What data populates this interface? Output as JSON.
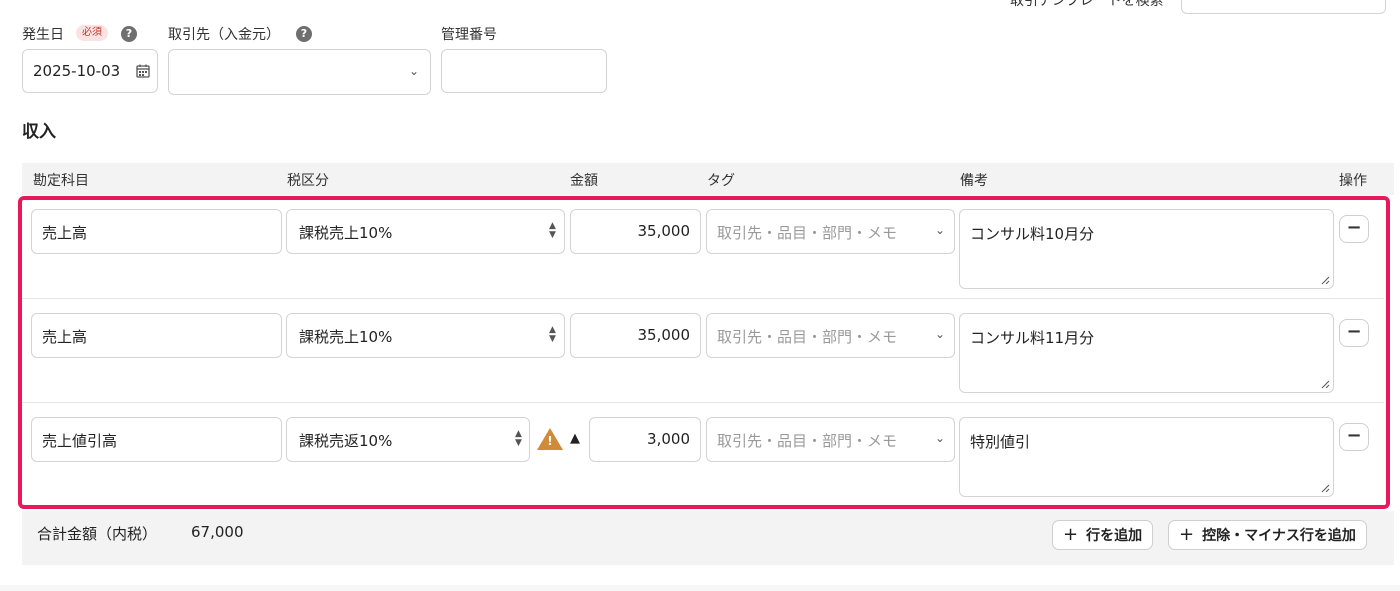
{
  "header": {
    "date_label": "発生日",
    "required_badge": "必須",
    "partner_label": "取引先（入金元）",
    "manage_no_label": "管理番号",
    "template_search_label": "取引テンプレートを検索"
  },
  "form": {
    "date_value": "2025-10-03",
    "partner_value": "",
    "manage_no_value": ""
  },
  "section": {
    "title": "収入"
  },
  "table": {
    "headers": [
      "勘定科目",
      "税区分",
      "金額",
      "タグ",
      "備考",
      "操作"
    ],
    "tag_placeholder": "取引先・品目・部門・メモ",
    "rows": [
      {
        "account": "売上高",
        "tax": "課税売上10%",
        "amount": "35,000",
        "note": "コンサル料10月分"
      },
      {
        "account": "売上高",
        "tax": "課税売上10%",
        "amount": "35,000",
        "note": "コンサル料11月分"
      },
      {
        "account": "売上値引高",
        "tax": "課税売返10%",
        "amount": "3,000",
        "note": "特別値引",
        "minus_mark": "▲"
      }
    ]
  },
  "footer": {
    "total_label": "合計金額（内税）",
    "total_value": "67,000",
    "add_row_label": "行を追加",
    "add_minus_row_label": "控除・マイナス行を追加"
  },
  "colors": {
    "highlight": "#e8195a",
    "warning": "#d08a38"
  }
}
